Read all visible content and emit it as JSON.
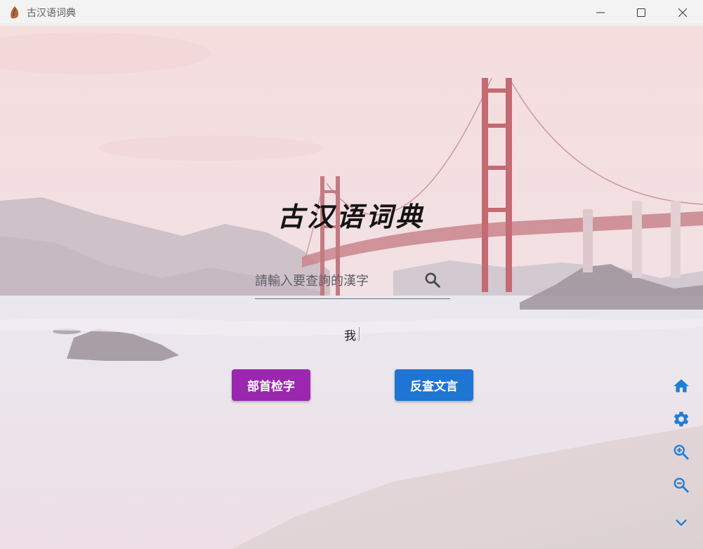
{
  "window": {
    "title": "古汉语词典",
    "controls": [
      "minimize",
      "maximize",
      "close"
    ]
  },
  "main": {
    "app_title": "古汉语词典",
    "search": {
      "placeholder": "請輸入要查詢的漢字",
      "value": "",
      "icon": "search-icon"
    },
    "glyph_preview": "我",
    "buttons": {
      "radical_lookup": "部首检字",
      "reverse_lookup": "反查文言"
    }
  },
  "side_toolbar": [
    {
      "name": "home",
      "icon": "home-icon"
    },
    {
      "name": "settings",
      "icon": "gear-icon"
    },
    {
      "name": "zoom_in",
      "icon": "zoom-in-icon"
    },
    {
      "name": "zoom_out",
      "icon": "zoom-out-icon"
    },
    {
      "name": "more",
      "icon": "chevron-down-icon"
    }
  ],
  "colors": {
    "radical_button": "#9b27af",
    "reverse_button": "#1e75d4",
    "side_icons": "#1e7fd8",
    "title_bar": "#f3f3f3"
  }
}
